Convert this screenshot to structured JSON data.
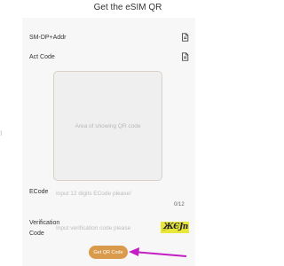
{
  "page": {
    "title": "Get the eSIM QR"
  },
  "fields": {
    "smdp_label": "SM-DP+Addr",
    "act_code_label": "Act Code",
    "copy_icon": "document-icon"
  },
  "qr": {
    "placeholder": "Area of showing QR code"
  },
  "ecode": {
    "label": "ECode",
    "placeholder": "Input 12 digits ECode please!",
    "value": "",
    "counter": "0/12"
  },
  "verification": {
    "label": "Verification Code",
    "placeholder": "Input verification code please",
    "value": "",
    "captcha_text": "ЖЄJn"
  },
  "actions": {
    "get_qr_label": "Get QR Code"
  },
  "colors": {
    "accent": "#d99b4b",
    "captcha_bg": "#e9e838",
    "annotation_arrow": "#c41ec4"
  }
}
